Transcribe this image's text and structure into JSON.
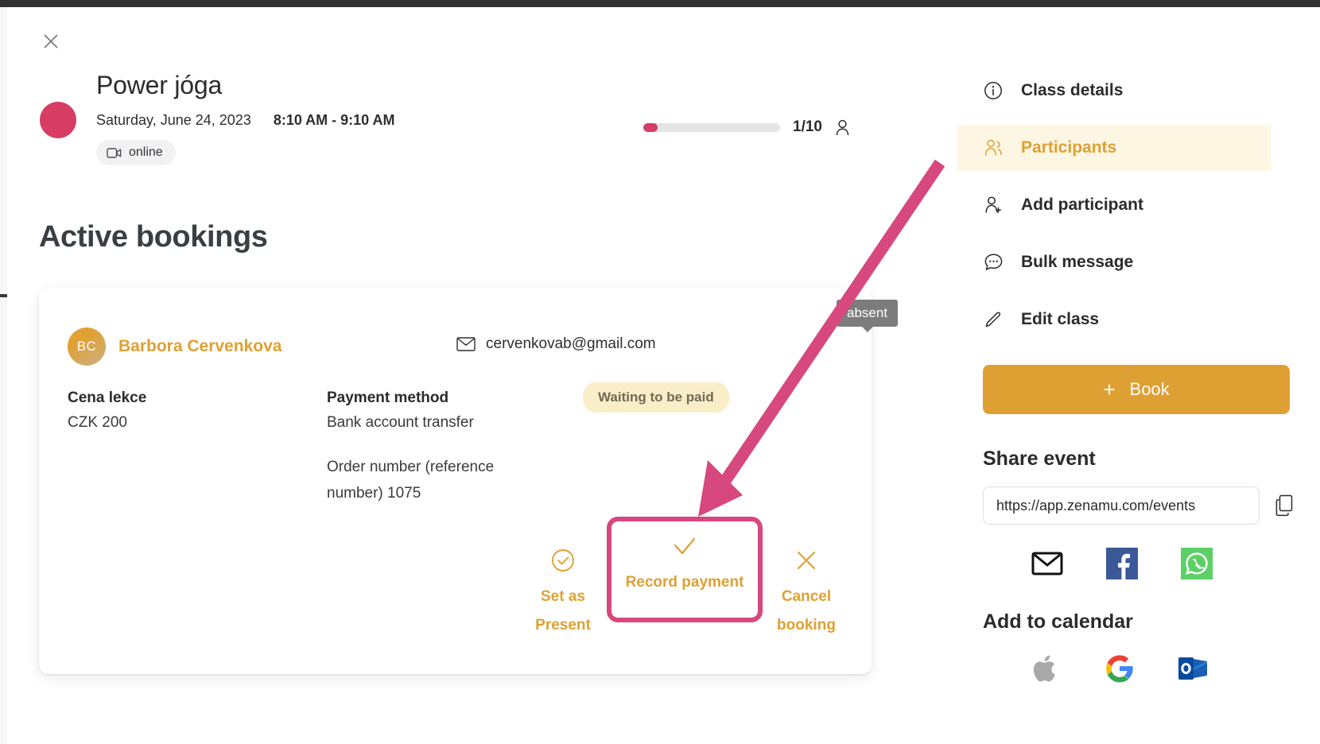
{
  "event": {
    "title": "Power jóga",
    "date": "Saturday, June 24, 2023",
    "time": "8:10 AM - 9:10 AM",
    "tag": "online",
    "tag_icon": "video-camera-icon",
    "dot_color": "#d73c64",
    "capacity_text": "1/10",
    "capacity_current": 1,
    "capacity_max": 10
  },
  "bookings_section": {
    "heading": "Active bookings"
  },
  "booking": {
    "avatar_initials": "BC",
    "name": "Barbora Cervenkova",
    "email": "cervenkovab@gmail.com",
    "email_icon": "envelope-icon",
    "price_label": "Cena lekce",
    "price_value": "CZK 200",
    "payment_label": "Payment method",
    "payment_value": "Bank account transfer",
    "order_text": "Order number (reference number) 1075",
    "status_badge": "Waiting to be paid",
    "tooltip": "absent",
    "actions": [
      {
        "label": "Set as Present",
        "icon": "check-circle-icon",
        "highlighted": false
      },
      {
        "label": "Record payment",
        "icon": "check-icon",
        "highlighted": true
      },
      {
        "label": "Cancel booking",
        "icon": "x-icon",
        "highlighted": false
      }
    ]
  },
  "sidebar": {
    "nav": [
      {
        "label": "Class details",
        "icon": "info-circle-icon",
        "active": false
      },
      {
        "label": "Participants",
        "icon": "participants-icon",
        "active": true
      },
      {
        "label": "Add participant",
        "icon": "person-plus-icon",
        "active": false
      },
      {
        "label": "Bulk message",
        "icon": "chat-bubble-icon",
        "active": false
      },
      {
        "label": "Edit class",
        "icon": "pencil-icon",
        "active": false
      }
    ],
    "book_button": "Book",
    "book_plus": "+",
    "share_title": "Share event",
    "share_url": "https://app.zenamu.com/events",
    "copy_icon": "copy-icon",
    "social": [
      {
        "name": "email-share",
        "icon": "envelope-filled-icon"
      },
      {
        "name": "facebook-share",
        "icon": "facebook-icon"
      },
      {
        "name": "whatsapp-share",
        "icon": "whatsapp-icon"
      }
    ],
    "calendar_title": "Add to calendar",
    "calendars": [
      {
        "name": "apple-calendar",
        "icon": "apple-icon"
      },
      {
        "name": "google-calendar",
        "icon": "google-icon"
      },
      {
        "name": "outlook-calendar",
        "icon": "outlook-icon"
      }
    ]
  },
  "colors": {
    "accent_orange": "#dfa033",
    "accent_pink": "#d6487e",
    "event_pink": "#d73c64",
    "badge_bg": "#faeec9",
    "active_nav_bg": "#fdf6e3"
  }
}
